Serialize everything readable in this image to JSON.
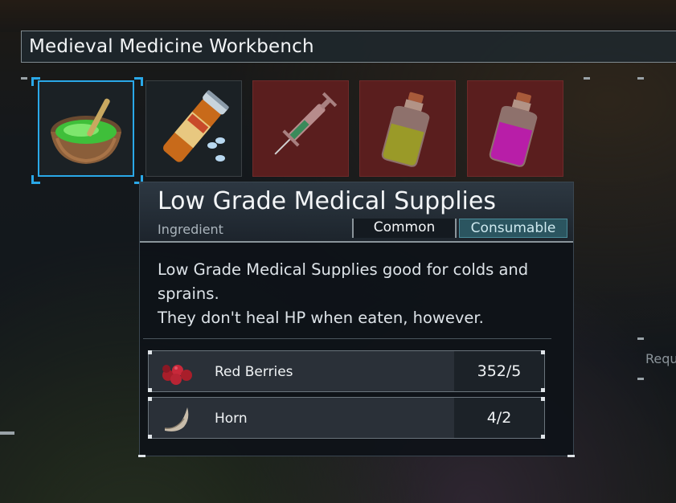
{
  "workbench": {
    "title": "Medieval Medicine Workbench"
  },
  "slots": [
    {
      "icon": "bowl-medicine-icon",
      "selected": true
    },
    {
      "icon": "pill-bottle-icon",
      "selected": false
    },
    {
      "icon": "syringe-icon",
      "selected": false
    },
    {
      "icon": "yellow-potion-icon",
      "selected": false
    },
    {
      "icon": "purple-potion-icon",
      "selected": false
    }
  ],
  "item": {
    "name": "Low Grade Medical Supplies",
    "type": "Ingredient",
    "tags": [
      "Common",
      "Consumable"
    ],
    "description": [
      "Low Grade Medical Supplies good for colds and",
      "sprains.",
      "They don't heal HP when eaten, however."
    ]
  },
  "ingredients": [
    {
      "name": "Red Berries",
      "count": "352/5",
      "icon": "red-berries-icon"
    },
    {
      "name": "Horn",
      "count": "4/2",
      "icon": "horn-icon"
    }
  ],
  "side_label": "Requ",
  "colors": {
    "selection": "#2aa8e8",
    "consumable_tag": "#2b5560",
    "locked_slot": "#5a1e1e"
  }
}
